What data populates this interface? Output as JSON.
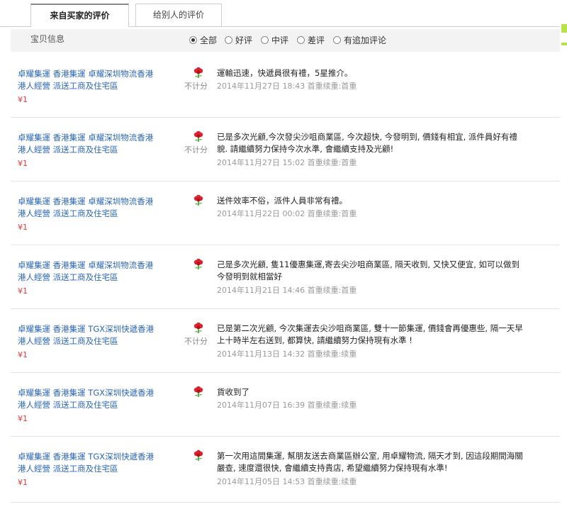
{
  "tabs": {
    "received": "来自买家的评价",
    "given": "给别人的评价"
  },
  "filter": {
    "product_info": "宝贝信息",
    "options": [
      "全部",
      "好评",
      "中评",
      "差评",
      "有追加评论"
    ],
    "selected": "全部"
  },
  "reviews": [
    {
      "title_line1": "卓耀集運 香港集運 卓耀深圳物流香港",
      "title_line2": "港人經營 派送工商及住宅區",
      "price": "¥1",
      "no_score": "不计分",
      "content_line1": "運輸迅速，快遞員很有禮，5星推介。",
      "content_line2": "",
      "date": "2014年11月27日 18:43 首重续重:首重"
    },
    {
      "title_line1": "卓耀集運 香港集運 卓耀深圳物流香港",
      "title_line2": "港人經營 派送工商及住宅區",
      "price": "¥1",
      "no_score": "不计分",
      "content_line1": "已是多次光顧,今次發尖沙咀商業區, 今次超快, 今發明到, 價錢有相宜, 派件員好有禮",
      "content_line2": "貌. 請繼續努力保持今次水準, 會繼續支持及光顧!",
      "date": "2014年11月27日 15:02 首重续重:首重"
    },
    {
      "title_line1": "卓耀集運 香港集運 卓耀深圳物流香港",
      "title_line2": "港人經營 派送工商及住宅區",
      "price": "¥1",
      "no_score": "",
      "content_line1": "送件效率不俗，派件人員非常有禮。",
      "content_line2": "",
      "date": "2014年11月22日 00:02 首重续重:首重"
    },
    {
      "title_line1": "卓耀集運 香港集運 卓耀深圳物流香港",
      "title_line2": "港人經營 派送工商及住宅區",
      "price": "¥1",
      "no_score": "",
      "content_line1": "己是多次光顧, 隻11優惠集運,寄去尖沙咀商業區, 隔天收到, 又快又便宜, 如可以做到",
      "content_line2": "今發明到就相當好",
      "date": "2014年11月21日 14:46 首重续重:首重"
    },
    {
      "title_line1": "卓耀集運 香港集運 TGX深圳快遞香港",
      "title_line2": "港人經營 派送工商及住宅區",
      "price": "¥1",
      "no_score": "不计分",
      "content_line1": "已是第二次光顧, 今次集運去尖沙咀商業區, 雙十一節集運, 價錢會再優惠些, 隔一天早",
      "content_line2": "上十時半左右送到, 都算快, 請繼續努力保持現有水準 !",
      "date": "2014年11月13日 14:32 首重续重:续重"
    },
    {
      "title_line1": "卓耀集運 香港集運 TGX深圳快遞香港",
      "title_line2": "港人經營 派送工商及住宅區",
      "price": "¥1",
      "no_score": "",
      "content_line1": "貨收到了",
      "content_line2": "",
      "date": "2014年11月07日 16:39 首重续重:续重"
    },
    {
      "title_line1": "卓耀集運 香港集運 TGX深圳快遞香港",
      "title_line2": "港人經營 派送工商及住宅區",
      "price": "¥1",
      "no_score": "",
      "content_line1": "第一次用這間集運, 幫朋友送去商業區辦公室, 用卓耀物流, 隔天才到, 因這段期間海關",
      "content_line2": "嚴查, 速度還很快, 會繼續支持貴店, 希望繼續努力保持現有水準!",
      "date": "2014年11月05日 14:53 首重续重:续重"
    }
  ],
  "colors": {
    "link": "#2a66b6",
    "price": "#e4393c",
    "meta": "#999999",
    "header_bg": "#f3f3f3",
    "flower": "#d9232e"
  }
}
